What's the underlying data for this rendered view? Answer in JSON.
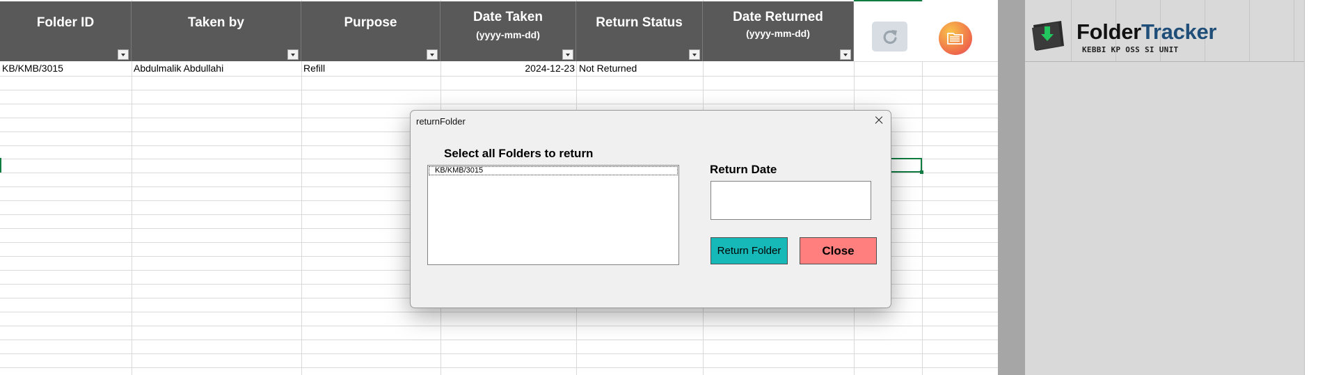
{
  "sheet": {
    "columns": [
      {
        "title": "Folder ID",
        "subtitle": ""
      },
      {
        "title": "Taken by",
        "subtitle": ""
      },
      {
        "title": "Purpose",
        "subtitle": ""
      },
      {
        "title": "Date Taken",
        "subtitle": "(yyyy-mm-dd)"
      },
      {
        "title": "Return Status",
        "subtitle": ""
      },
      {
        "title": "Date Returned",
        "subtitle": "(yyyy-mm-dd)"
      }
    ],
    "rows": [
      {
        "folder_id": "KB/KMB/3015",
        "taken_by": "Abdulmalik Abdullahi",
        "purpose": "Refill",
        "date_taken": "2024-12-23",
        "return_status": "Not Returned",
        "date_returned": ""
      }
    ],
    "refresh_icon": "refresh-icon",
    "folder_icon": "folder-icon"
  },
  "brand": {
    "name_part1": "Folder",
    "name_part2": "Tracker",
    "subtitle": "KEBBI KP OSS SI UNIT",
    "accent": "#1f4e79"
  },
  "dialog": {
    "title": "returnFolder",
    "select_label": "Select all Folders to return",
    "list_items": [
      "KB/KMB/3015"
    ],
    "date_label": "Return Date",
    "date_value": "",
    "return_button": "Return Folder",
    "close_button": "Close",
    "return_button_color": "#17b8b8",
    "close_button_color": "#ff7f7f"
  }
}
